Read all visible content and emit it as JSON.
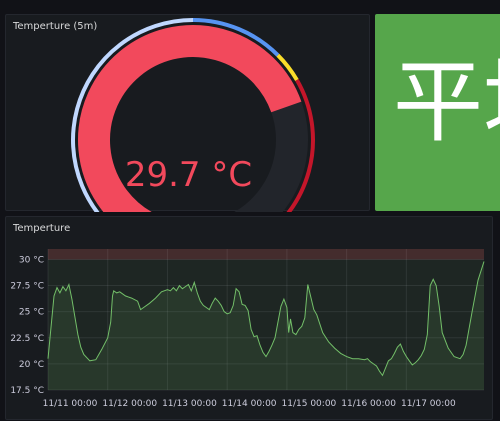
{
  "gauge_panel": {
    "title": "Temperture (5m)",
    "value_text": "29.7 °C",
    "value": 29.7,
    "min": 15,
    "max": 35,
    "value_color": "#f2495c",
    "track_color": "#22252b",
    "thresholds": [
      {
        "from": 15,
        "to": 25,
        "color": "#c0d8ff"
      },
      {
        "from": 25,
        "to": 28,
        "color": "#5794f2"
      },
      {
        "from": 28,
        "to": 29,
        "color": "#fade2a"
      },
      {
        "from": 29,
        "to": 35,
        "color": "#c4162a"
      }
    ]
  },
  "stat_panel": {
    "text": "平均",
    "background": "#56a64b"
  },
  "graph_panel": {
    "title": "Temperture",
    "line_color": "#73bf69",
    "fill_color": "rgba(115,191,105,0.12)",
    "threshold_color": "rgba(242,73,92,0.18)"
  },
  "chart_data": {
    "type": "line",
    "title": "Temperture",
    "xlabel": "",
    "ylabel": "",
    "ylim": [
      17.5,
      31
    ],
    "xlim": [
      0,
      7.3
    ],
    "x_tick_labels": [
      "11/11 00:00",
      "11/12 00:00",
      "11/13 00:00",
      "11/14 00:00",
      "11/15 00:00",
      "11/16 00:00",
      "11/17 00:00"
    ],
    "y_tick_labels": [
      "17.5 °C",
      "20 °C",
      "22.5 °C",
      "25 °C",
      "27.5 °C",
      "30 °C"
    ],
    "y_ticks": [
      17.5,
      20,
      22.5,
      25,
      27.5,
      30
    ],
    "threshold_band": [
      30,
      31
    ],
    "series": [
      {
        "x": [
          0.0,
          0.05,
          0.1,
          0.15,
          0.2,
          0.25,
          0.3,
          0.35,
          0.4,
          0.45,
          0.5,
          0.55,
          0.6,
          0.7,
          0.8,
          0.9,
          1.0,
          1.05,
          1.08,
          1.1,
          1.15,
          1.2,
          1.3,
          1.4,
          1.5,
          1.55,
          1.6,
          1.7,
          1.8,
          1.9,
          2.0,
          2.05,
          2.1,
          2.15,
          2.2,
          2.25,
          2.3,
          2.35,
          2.4,
          2.45,
          2.5,
          2.55,
          2.6,
          2.65,
          2.7,
          2.75,
          2.8,
          2.85,
          2.9,
          2.95,
          3.0,
          3.05,
          3.1,
          3.15,
          3.2,
          3.25,
          3.3,
          3.35,
          3.4,
          3.45,
          3.5,
          3.55,
          3.6,
          3.65,
          3.7,
          3.75,
          3.8,
          3.9,
          3.95,
          4.0,
          4.03,
          4.06,
          4.1,
          4.15,
          4.2,
          4.25,
          4.3,
          4.35,
          4.4,
          4.45,
          4.5,
          4.6,
          4.7,
          4.8,
          4.9,
          5.0,
          5.1,
          5.2,
          5.3,
          5.35,
          5.4,
          5.45,
          5.5,
          5.55,
          5.6,
          5.65,
          5.7,
          5.75,
          5.8,
          5.85,
          5.9,
          5.95,
          6.0,
          6.05,
          6.1,
          6.15,
          6.2,
          6.25,
          6.3,
          6.35,
          6.4,
          6.45,
          6.5,
          6.55,
          6.6,
          6.7,
          6.8,
          6.9,
          6.95,
          7.0,
          7.1,
          7.2,
          7.3
        ],
        "y": [
          20.5,
          23.5,
          26.5,
          27.3,
          26.8,
          27.4,
          27.0,
          27.6,
          26.2,
          24.5,
          22.8,
          21.6,
          20.9,
          20.3,
          20.4,
          21.4,
          22.5,
          24.0,
          26.5,
          27.0,
          26.8,
          26.9,
          26.5,
          26.3,
          26.0,
          25.2,
          25.4,
          25.8,
          26.3,
          26.9,
          27.1,
          27.0,
          27.3,
          27.0,
          27.5,
          27.2,
          27.4,
          27.6,
          27.0,
          27.8,
          26.8,
          26.0,
          25.6,
          25.4,
          25.2,
          25.8,
          26.3,
          26.0,
          25.6,
          25.0,
          24.8,
          24.9,
          25.6,
          27.2,
          26.9,
          25.7,
          25.6,
          25.1,
          23.3,
          22.6,
          22.7,
          21.8,
          21.1,
          20.7,
          21.2,
          21.8,
          22.5,
          25.5,
          26.2,
          25.4,
          23.0,
          24.3,
          23.0,
          22.8,
          23.3,
          23.6,
          24.4,
          27.6,
          26.4,
          25.2,
          24.7,
          23.0,
          22.1,
          21.5,
          21.0,
          20.7,
          20.5,
          20.5,
          20.4,
          20.5,
          20.2,
          20.0,
          19.8,
          19.3,
          18.9,
          19.6,
          20.3,
          20.5,
          21.0,
          21.6,
          21.9,
          21.2,
          20.7,
          20.3,
          19.9,
          20.1,
          20.4,
          20.8,
          21.4,
          22.8,
          27.5,
          28.1,
          27.5,
          25.5,
          23.0,
          21.5,
          20.7,
          20.5,
          20.9,
          21.8,
          25.0,
          28.0,
          29.8
        ]
      }
    ]
  }
}
